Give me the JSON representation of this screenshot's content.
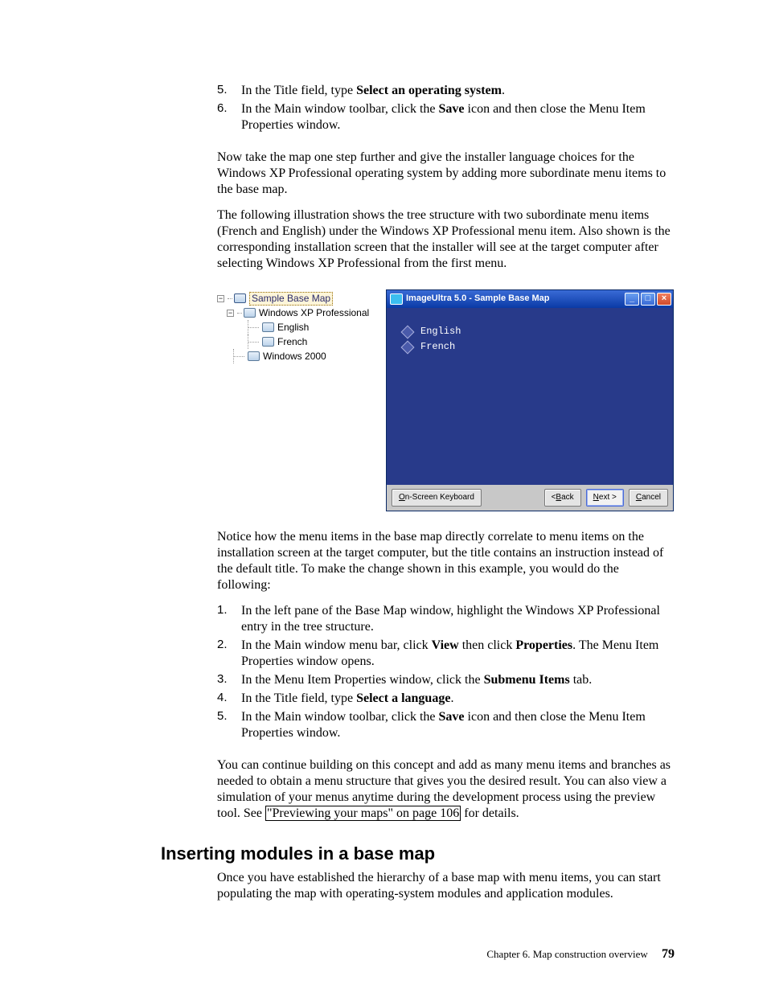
{
  "stepsA": [
    {
      "n": "5.",
      "text_a": "In the Title field, type ",
      "bold": "Select an operating system",
      "text_b": "."
    },
    {
      "n": "6.",
      "text_a": "In the Main window toolbar, click the ",
      "bold": "Save",
      "text_b": " icon and then close the Menu Item Properties window."
    }
  ],
  "para1": "Now take the map one step further and give the installer language choices for the Windows XP Professional operating system by adding more subordinate menu items to the base map.",
  "para2": "The following illustration shows the tree structure with two subordinate menu items (French and English) under the Windows XP Professional menu item. Also shown is the corresponding installation screen that the installer will see at the target computer after selecting Windows XP Professional from the first menu.",
  "tree": {
    "root": "Sample Base Map",
    "n1": "Windows XP Professional",
    "n1a": "English",
    "n1b": "French",
    "n2": "Windows 2000"
  },
  "installer": {
    "title": "ImageUltra 5.0 - Sample Base Map",
    "opt1": "English",
    "opt2": "French",
    "kbd": "On-Screen Keyboard",
    "back": "Back",
    "next": "Next >",
    "cancel": "Cancel"
  },
  "para3": "Notice how the menu items in the base map directly correlate to menu items on the installation screen at the target computer, but the title contains an instruction instead of the default title. To make the change shown in this example, you would do the following:",
  "stepsB": [
    {
      "n": "1.",
      "lines": [
        "In the left pane of the Base Map window, highlight the Windows XP Professional entry in the tree structure."
      ]
    },
    {
      "n": "2.",
      "view_prop": true
    },
    {
      "n": "3.",
      "submenu": true
    },
    {
      "n": "4.",
      "title_lang": true
    },
    {
      "n": "5.",
      "save_close": true
    }
  ],
  "sb2": {
    "a": "In the Main window menu bar, click ",
    "v": "View",
    "b": " then click ",
    "p": "Properties",
    "c": ". The Menu Item Properties window opens."
  },
  "sb3": {
    "a": "In the Menu Item Properties window, click the ",
    "t": "Submenu Items",
    "b": " tab."
  },
  "sb4": {
    "a": "In the Title field, type ",
    "t": "Select a language",
    "b": "."
  },
  "sb5": {
    "a": "In the Main window toolbar, click the ",
    "t": "Save",
    "b": " icon and then close the Menu Item Properties window."
  },
  "para4a": "You can continue building on this concept and add as many menu items and branches as needed to obtain a menu structure that gives you the desired result. You can also view a simulation of your menus anytime during the development process using the preview tool. See ",
  "para4link": "\"Previewing your maps\" on page 106",
  "para4b": " for details.",
  "heading": "Inserting modules in a base map",
  "para5": "Once you have established the hierarchy of a base map with menu items, you can start populating the map with operating-system modules and application modules.",
  "footer": {
    "chapter": "Chapter 6. Map construction overview",
    "page": "79"
  }
}
